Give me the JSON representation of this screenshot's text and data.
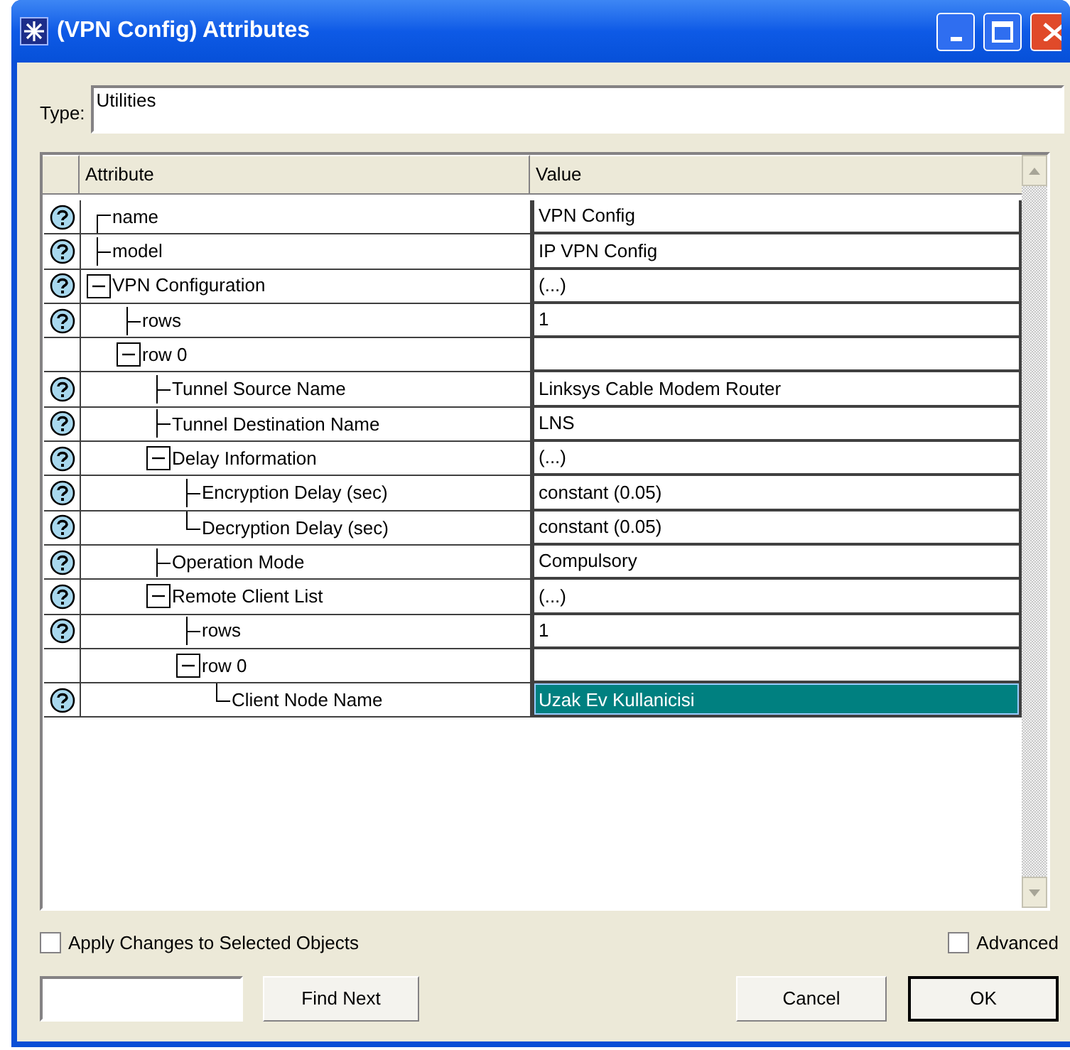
{
  "window": {
    "title": "(VPN Config) Attributes"
  },
  "type_field": {
    "label": "Type:",
    "value": "Utilities"
  },
  "table": {
    "columns": [
      "Attribute",
      "Value"
    ],
    "tree": [
      {
        "name": "name",
        "value": "VPN Config",
        "help": true,
        "selected": false
      },
      {
        "name": "model",
        "value": "IP VPN Config",
        "help": true,
        "selected": false
      },
      {
        "name": "VPN Configuration",
        "value": "(...)",
        "help": true,
        "selected": false,
        "expanded": true,
        "children": [
          {
            "name": "rows",
            "value": "1",
            "help": true,
            "selected": false
          },
          {
            "name": "row 0",
            "help": false,
            "selected": false,
            "expanded": true,
            "children": [
              {
                "name": "Tunnel Source Name",
                "value": "Linksys Cable Modem Router",
                "help": true,
                "selected": false
              },
              {
                "name": "Tunnel Destination Name",
                "value": "LNS",
                "help": true,
                "selected": false
              },
              {
                "name": "Delay Information",
                "value": "(...)",
                "help": true,
                "selected": false,
                "expanded": true,
                "children": [
                  {
                    "name": "Encryption Delay (sec)",
                    "value": "constant (0.05)",
                    "help": true,
                    "selected": false
                  },
                  {
                    "name": "Decryption Delay (sec)",
                    "value": "constant (0.05)",
                    "help": true,
                    "selected": false
                  }
                ]
              },
              {
                "name": "Operation Mode",
                "value": "Compulsory",
                "help": true,
                "selected": false
              },
              {
                "name": "Remote Client List",
                "value": "(...)",
                "help": true,
                "selected": false,
                "expanded": true,
                "children": [
                  {
                    "name": "rows",
                    "value": "1",
                    "help": true,
                    "selected": false
                  },
                  {
                    "name": "row 0",
                    "help": false,
                    "selected": false,
                    "expanded": true,
                    "children": [
                      {
                        "name": "Client Node Name",
                        "value": "Uzak Ev Kullanicisi",
                        "help": true,
                        "selected": true
                      }
                    ]
                  }
                ]
              }
            ]
          }
        ]
      }
    ]
  },
  "options": [
    {
      "label": "Apply Changes to Selected Objects",
      "checked": false
    },
    {
      "label": "Advanced",
      "checked": false
    }
  ],
  "find": {
    "button": "Find Next"
  },
  "buttons": [
    {
      "label": "Cancel",
      "default": false
    },
    {
      "label": "OK",
      "default": true
    }
  ]
}
